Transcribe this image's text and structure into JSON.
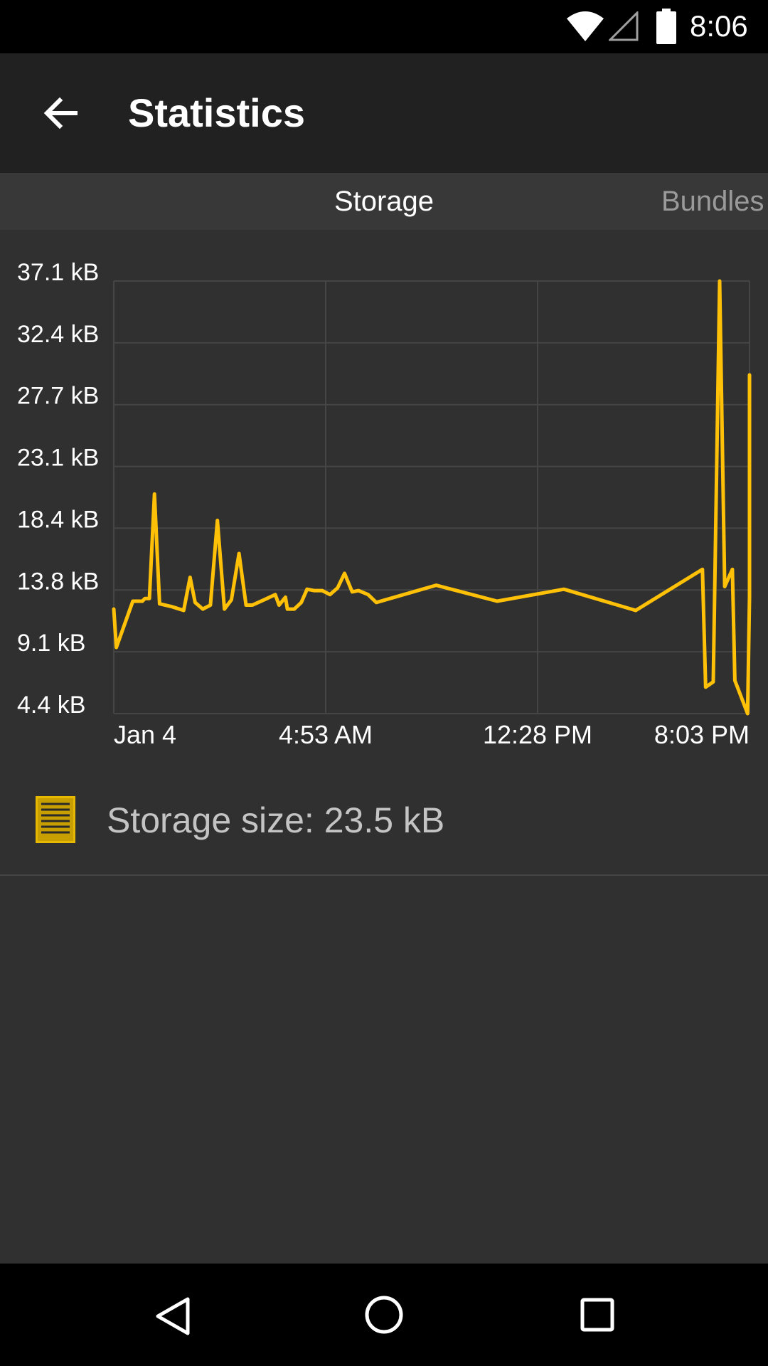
{
  "status_bar": {
    "time": "8:06",
    "icons": [
      "wifi-icon",
      "cell-signal-icon",
      "battery-icon"
    ]
  },
  "app_bar": {
    "title": "Statistics",
    "back_icon": "arrow-back-icon"
  },
  "tabs": [
    {
      "label": "Storage",
      "active": true
    },
    {
      "label": "Bundles",
      "active": false
    }
  ],
  "chart_data": {
    "type": "line",
    "yticks": [
      "37.1 kB",
      "32.4 kB",
      "27.7 kB",
      "23.1 kB",
      "18.4 kB",
      "13.8 kB",
      "9.1 kB",
      "4.4 kB"
    ],
    "xticks": [
      "Jan 4",
      "4:53 AM",
      "12:28 PM",
      "8:03 PM"
    ],
    "ylim": [
      4.4,
      37.1
    ],
    "y_unit": "kB",
    "line_color": "#ffc107",
    "grid": true,
    "series": [
      {
        "values": [
          12.3,
          9.4,
          12.9,
          12.9,
          12.9,
          13.1,
          13.1,
          21.0,
          12.7,
          12.5,
          12.4,
          12.2,
          14.7,
          12.8,
          12.3,
          12.6,
          19.0,
          12.3,
          13.0,
          16.5,
          12.6,
          12.6,
          13.1,
          13.4,
          12.6,
          13.2,
          12.3,
          12.3,
          12.8,
          13.8,
          13.7,
          13.7,
          13.4,
          13.9,
          15.0,
          13.6,
          13.7,
          13.4,
          12.8,
          14.1,
          12.9,
          13.8,
          12.2,
          15.3,
          6.4,
          6.8,
          37.1,
          14.0,
          15.3,
          6.9,
          5.9,
          4.4,
          13.2,
          30.0
        ],
        "x_norm": [
          0.0,
          0.004,
          0.03,
          0.039,
          0.045,
          0.049,
          0.056,
          0.064,
          0.072,
          0.09,
          0.097,
          0.11,
          0.12,
          0.128,
          0.14,
          0.152,
          0.163,
          0.174,
          0.185,
          0.197,
          0.208,
          0.218,
          0.241,
          0.254,
          0.26,
          0.27,
          0.273,
          0.284,
          0.295,
          0.304,
          0.315,
          0.328,
          0.34,
          0.352,
          0.363,
          0.375,
          0.385,
          0.4,
          0.413,
          0.507,
          0.603,
          0.708,
          0.821,
          0.926,
          0.931,
          0.943,
          0.953,
          0.961,
          0.973,
          0.977,
          0.985,
          0.997,
          1.0,
          1.0
        ]
      }
    ]
  },
  "storage": {
    "icon": "storage-doc-icon",
    "label": "Storage size: 23.5 kB"
  },
  "nav_bar": {
    "icons": [
      "nav-back-icon",
      "nav-home-icon",
      "nav-recents-icon"
    ]
  }
}
